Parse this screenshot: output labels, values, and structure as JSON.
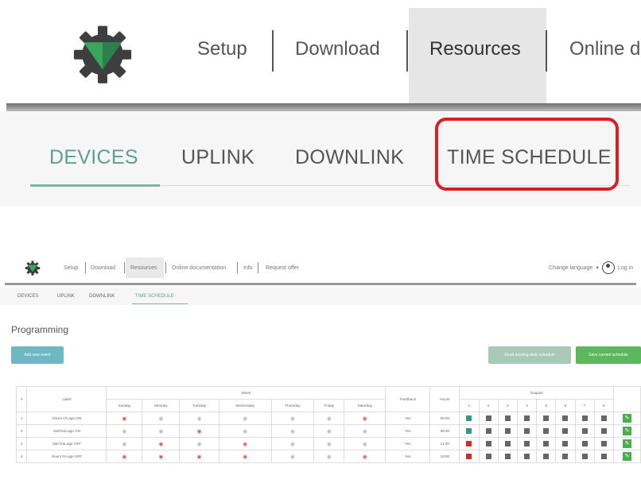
{
  "zoom_nav": {
    "links": [
      "Setup",
      "Download",
      "Resources",
      "Online d"
    ],
    "active": "Resources"
  },
  "zoom_tabs": {
    "tabs": [
      "DEVICES",
      "UPLINK",
      "DOWNLINK",
      "TIME SCHEDULE"
    ],
    "active": "DEVICES"
  },
  "mini": {
    "nav_links": [
      "Setup",
      "Download",
      "Resources",
      "Online documentation",
      "Info",
      "Request offer"
    ],
    "change_language": "Change language",
    "login": "Log in",
    "tabs": [
      "DEVICES",
      "UPLINK",
      "DOWNLINK",
      "TIME SCHEDULE"
    ],
    "page_title": "Programming",
    "buttons": {
      "add_event": "Add new event",
      "read_schedule": "Read existing daily schedule",
      "save_schedule": "Save current schedule"
    },
    "table": {
      "headers": {
        "index": "#",
        "label": "Label",
        "week": "Week",
        "days": [
          "Sunday",
          "Monday",
          "Tuesday",
          "Wednesday",
          "Thursday",
          "Friday",
          "Saturday"
        ],
        "feedback": "Feedback",
        "hours": "Hours",
        "outputs": "Outputs",
        "output_numbers": [
          "1",
          "2",
          "3",
          "4",
          "5",
          "6",
          "7",
          "8"
        ]
      },
      "rows": [
        {
          "index": "1",
          "label": "Hours Ch.age ON",
          "feedback": "Yes",
          "hours": "08:00"
        },
        {
          "index": "2",
          "label": "Salt feat.age ON",
          "feedback": "Yes",
          "hours": "09:30"
        },
        {
          "index": "3",
          "label": "Salt feat.age OFF",
          "feedback": "Yes",
          "hours": "11:00"
        },
        {
          "index": "4",
          "label": "Hours Fe.age OFF",
          "feedback": "Yes",
          "hours": "18:00"
        }
      ]
    }
  },
  "colors": {
    "accent_teal": "#5f9f8f",
    "highlight_red": "#d81f26",
    "button_green": "#5cb85c",
    "button_blue": "#6fb7c3"
  }
}
